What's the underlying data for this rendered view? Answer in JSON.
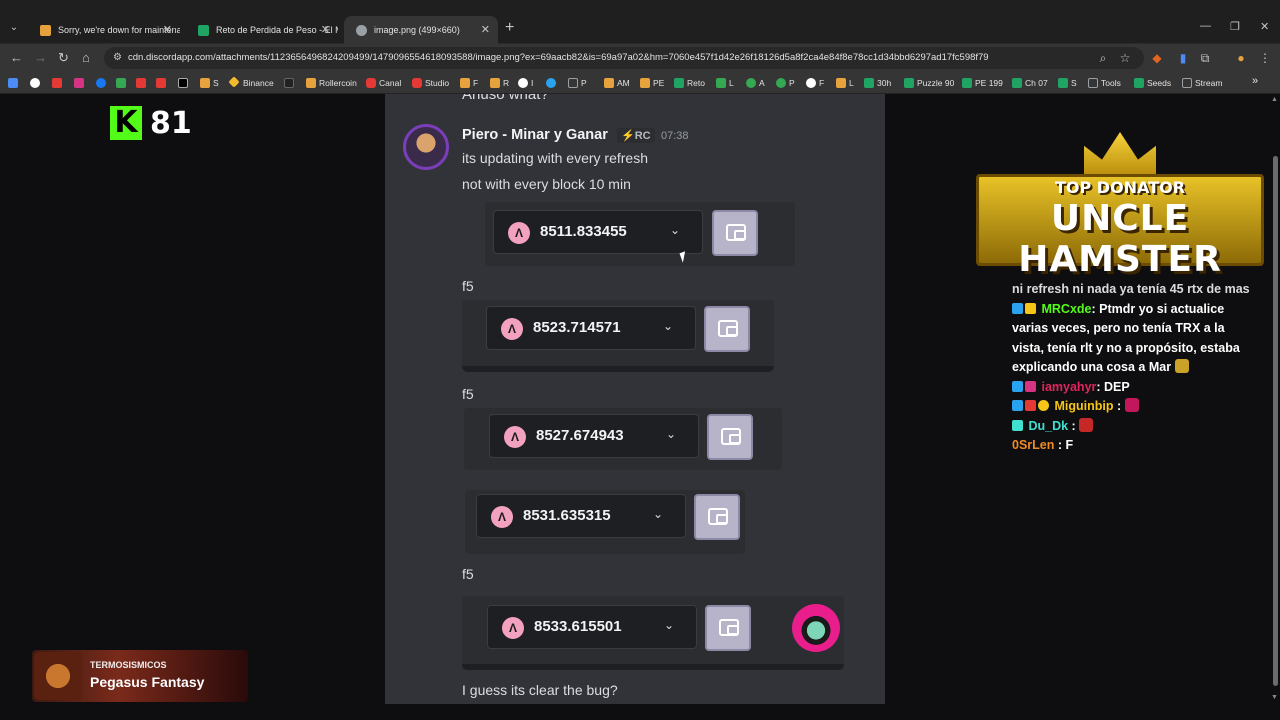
{
  "browser": {
    "tabs": [
      {
        "title": "Sorry, we're down for maintena",
        "active": false,
        "color": "#e6a23c"
      },
      {
        "title": "Reto de Perdida de Peso - El M",
        "active": false,
        "color": "#1fa463"
      },
      {
        "title": "image.png (499×660)",
        "active": true,
        "color": "#9aa0a6"
      }
    ],
    "url": "cdn.discordapp.com/attachments/1123656496824209499/1479096554618093588/image.png?ex=69aacb82&is=69a97a02&hm=7060e457f1d42e26f18126d5a8f2ca4e84f8e78cc1d34bbd6297ad17fc598f79",
    "bookmarks": [
      {
        "label": "",
        "color": "#4c8bf5"
      },
      {
        "label": "",
        "color": "#ffffff"
      },
      {
        "label": "",
        "color": "#e53935"
      },
      {
        "label": "",
        "color": "#d63384"
      },
      {
        "label": "",
        "color": "#1877f2"
      },
      {
        "label": "",
        "color": "#34a853"
      },
      {
        "label": "",
        "color": "#e53935"
      },
      {
        "label": "",
        "color": "#e53935"
      },
      {
        "label": "",
        "color": "#000000"
      },
      {
        "label": "S",
        "color": "#e6a23c"
      },
      {
        "label": "Binance",
        "color": "#f3ba2f"
      },
      {
        "label": "",
        "color": "#222222"
      },
      {
        "label": "Rollercoin",
        "color": "#e6a23c"
      },
      {
        "label": "Canal",
        "color": "#e53935"
      },
      {
        "label": "Studio",
        "color": "#e53935"
      },
      {
        "label": "F",
        "color": "#e6a23c"
      },
      {
        "label": "R",
        "color": "#e6a23c"
      },
      {
        "label": "I",
        "color": "#ffffff"
      },
      {
        "label": "",
        "color": "#2aa3ef"
      },
      {
        "label": "P",
        "color": "#9aa0a6"
      },
      {
        "label": "AM",
        "color": "#e6a23c"
      },
      {
        "label": "PE",
        "color": "#e6a23c"
      },
      {
        "label": "Reto",
        "color": "#1fa463"
      },
      {
        "label": "L",
        "color": "#34a853"
      },
      {
        "label": "A",
        "color": "#34a853"
      },
      {
        "label": "P",
        "color": "#34a853"
      },
      {
        "label": "F",
        "color": "#ffffff"
      },
      {
        "label": "L",
        "color": "#e6a23c"
      },
      {
        "label": "30h",
        "color": "#1fa463"
      },
      {
        "label": "Puzzle 90",
        "color": "#1fa463"
      },
      {
        "label": "PE 199",
        "color": "#1fa463"
      },
      {
        "label": "Ch 07",
        "color": "#1fa463"
      },
      {
        "label": "S",
        "color": "#1fa463"
      },
      {
        "label": "Tools",
        "color": "#9aa0a6"
      },
      {
        "label": "Seeds",
        "color": "#1fa463"
      },
      {
        "label": "Stream",
        "color": "#9aa0a6"
      }
    ]
  },
  "discord": {
    "cut_text": "Anuso what?",
    "username": "Piero - Minar y Ganar",
    "tag": "⚡RC",
    "time": "07:38",
    "messages": [
      "its updating with every refresh",
      "not with every block 10 min"
    ],
    "f5_label": "f5",
    "balances": [
      "8511.833455",
      "8523.714571",
      "8527.674943",
      "8531.635315",
      "8533.615501"
    ],
    "last_message": "I guess its clear the bug?"
  },
  "kick": {
    "viewers": "81"
  },
  "donator": {
    "title": "TOP DONATOR",
    "name": "UNCLE HAMSTER"
  },
  "chat": {
    "cut_line": "ni refresh ni nada ya tenía 45 rtx de mas",
    "lines": [
      {
        "user": "MRCxde",
        "color": "#53fc18",
        "text": ": Ptmdr yo si actualice varias veces, pero no tenía TRX a la vista, tenía rlt y no a propósito, estaba explicando una cosa a Mar"
      },
      {
        "user": "iamyahyr",
        "color": "#e0245e",
        "text": ": DEP"
      },
      {
        "user": "Miguinbip",
        "color": "#f5c518",
        "text": " :"
      },
      {
        "user": "Du_Dk",
        "color": "#40e0d0",
        "text": " :"
      },
      {
        "user": "0SrLen",
        "color": "#f08a24",
        "text": " : F"
      }
    ]
  },
  "streamer": {
    "channel": "TERMOSISMICOS",
    "game": "Pegasus Fantasy"
  }
}
